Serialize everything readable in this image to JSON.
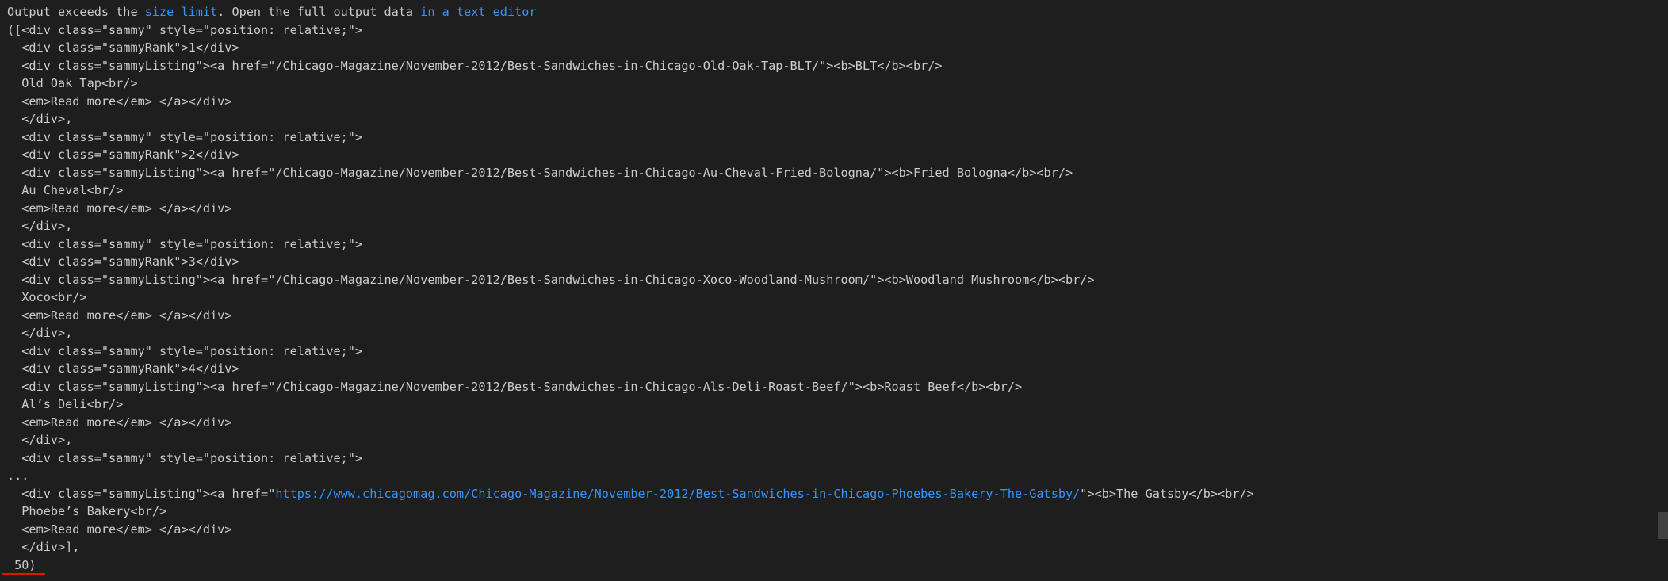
{
  "notice": {
    "prefix": "Output exceeds the ",
    "size_limit_link": "size limit",
    "middle": ". Open the full output data ",
    "text_editor_link": "in a text editor"
  },
  "lines_a": [
    "([<div class=\"sammy\" style=\"position: relative;\">",
    "  <div class=\"sammyRank\">1</div>",
    "  <div class=\"sammyListing\"><a href=\"/Chicago-Magazine/November-2012/Best-Sandwiches-in-Chicago-Old-Oak-Tap-BLT/\"><b>BLT</b><br/>",
    "  Old Oak Tap<br/>",
    "  <em>Read more</em> </a></div>",
    "  </div>,",
    "  <div class=\"sammy\" style=\"position: relative;\">",
    "  <div class=\"sammyRank\">2</div>",
    "  <div class=\"sammyListing\"><a href=\"/Chicago-Magazine/November-2012/Best-Sandwiches-in-Chicago-Au-Cheval-Fried-Bologna/\"><b>Fried Bologna</b><br/>",
    "  Au Cheval<br/>",
    "  <em>Read more</em> </a></div>",
    "  </div>,",
    "  <div class=\"sammy\" style=\"position: relative;\">",
    "  <div class=\"sammyRank\">3</div>",
    "  <div class=\"sammyListing\"><a href=\"/Chicago-Magazine/November-2012/Best-Sandwiches-in-Chicago-Xoco-Woodland-Mushroom/\"><b>Woodland Mushroom</b><br/>",
    "  Xoco<br/>",
    "  <em>Read more</em> </a></div>",
    "  </div>,",
    "  <div class=\"sammy\" style=\"position: relative;\">",
    "  <div class=\"sammyRank\">4</div>",
    "  <div class=\"sammyListing\"><a href=\"/Chicago-Magazine/November-2012/Best-Sandwiches-in-Chicago-Als-Deli-Roast-Beef/\"><b>Roast Beef</b><br/>",
    "  Al’s Deli<br/>",
    "  <em>Read more</em> </a></div>",
    "  </div>,",
    "  <div class=\"sammy\" style=\"position: relative;\">"
  ],
  "ellipsis": "...",
  "gatsby": {
    "prefix": "  <div class=\"sammyListing\"><a href=\"",
    "url": "https://www.chicagomag.com/Chicago-Magazine/November-2012/Best-Sandwiches-in-Chicago-Phoebes-Bakery-The-Gatsby/",
    "suffix": "\"><b>The Gatsby</b><br/>"
  },
  "lines_b": [
    "  Phoebe’s Bakery<br/>",
    "  <em>Read more</em> </a></div>",
    "  </div>],",
    " 50)"
  ]
}
